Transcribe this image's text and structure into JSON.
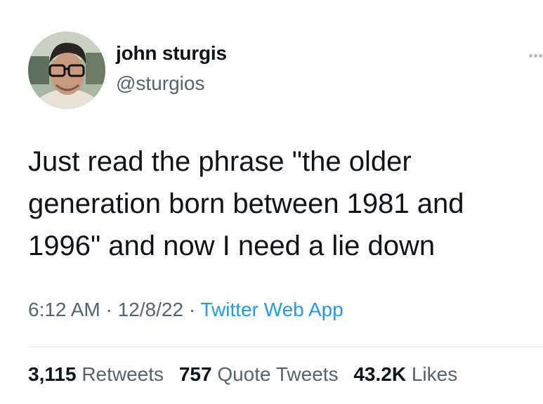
{
  "author": {
    "display_name": "john sturgis",
    "handle": "@sturgios",
    "avatar_icon": "profile-photo"
  },
  "tweet": {
    "text_lines": [
      "Just read the phrase \"the older",
      "generation born between 1981 and",
      "1996\" and now I need a lie down"
    ]
  },
  "meta": {
    "time": "6:12 AM",
    "date": "12/8/22",
    "separator": " · ",
    "source": "Twitter Web App"
  },
  "stats": {
    "retweets": {
      "count": "3,115",
      "label": "Retweets"
    },
    "quote_tweets": {
      "count": "757",
      "label": "Quote Tweets"
    },
    "likes": {
      "count": "43.2K",
      "label": "Likes"
    }
  },
  "colors": {
    "text": "#0f1419",
    "secondary": "#536471",
    "link": "#1d9bf0",
    "divider": "#e1e6ea"
  },
  "icons": {
    "more": "more-options-icon"
  }
}
